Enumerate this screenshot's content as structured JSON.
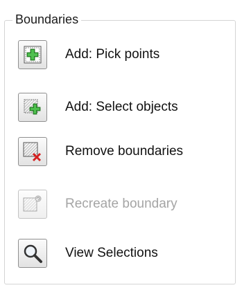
{
  "group": {
    "title": "Boundaries"
  },
  "items": [
    {
      "label": "Add: Pick points",
      "icon": "add-pick-points-icon",
      "enabled": true
    },
    {
      "label": "Add: Select objects",
      "icon": "add-select-objects-icon",
      "enabled": true
    },
    {
      "label": "Remove boundaries",
      "icon": "remove-boundaries-icon",
      "enabled": true
    },
    {
      "label": "Recreate boundary",
      "icon": "recreate-boundary-icon",
      "enabled": false
    },
    {
      "label": "View Selections",
      "icon": "magnifier-icon",
      "enabled": true
    }
  ],
  "colors": {
    "add_green": "#2e9a2e",
    "remove_red": "#d42020",
    "disabled_text": "#a5a5a5"
  }
}
